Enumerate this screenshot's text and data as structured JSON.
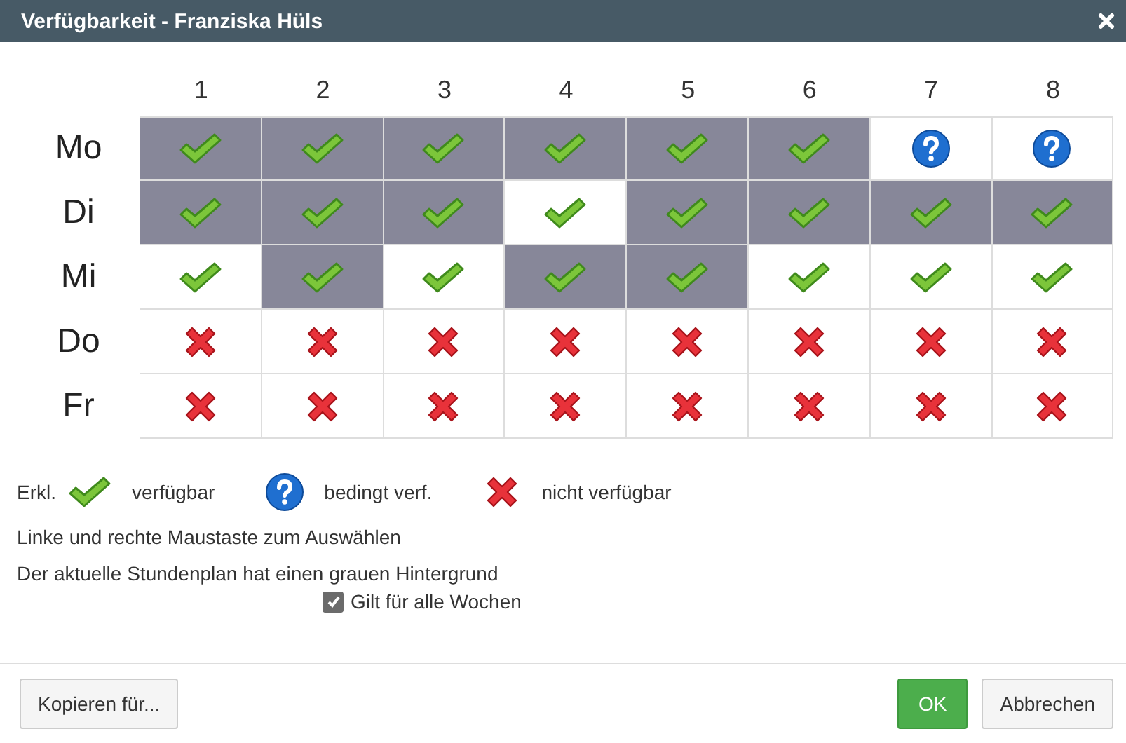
{
  "window": {
    "title": "Verfügbarkeit - Franziska Hüls"
  },
  "columns": [
    "1",
    "2",
    "3",
    "4",
    "5",
    "6",
    "7",
    "8"
  ],
  "rows": [
    {
      "day": "Mo",
      "cells": [
        {
          "kind": "yes",
          "current": true
        },
        {
          "kind": "yes",
          "current": true
        },
        {
          "kind": "yes",
          "current": true
        },
        {
          "kind": "yes",
          "current": true
        },
        {
          "kind": "yes",
          "current": true
        },
        {
          "kind": "yes",
          "current": true
        },
        {
          "kind": "maybe",
          "current": false
        },
        {
          "kind": "maybe",
          "current": false
        }
      ]
    },
    {
      "day": "Di",
      "cells": [
        {
          "kind": "yes",
          "current": true
        },
        {
          "kind": "yes",
          "current": true
        },
        {
          "kind": "yes",
          "current": true
        },
        {
          "kind": "yes",
          "current": false
        },
        {
          "kind": "yes",
          "current": true
        },
        {
          "kind": "yes",
          "current": true
        },
        {
          "kind": "yes",
          "current": true
        },
        {
          "kind": "yes",
          "current": true
        }
      ]
    },
    {
      "day": "Mi",
      "cells": [
        {
          "kind": "yes",
          "current": false
        },
        {
          "kind": "yes",
          "current": true
        },
        {
          "kind": "yes",
          "current": false
        },
        {
          "kind": "yes",
          "current": true
        },
        {
          "kind": "yes",
          "current": true
        },
        {
          "kind": "yes",
          "current": false
        },
        {
          "kind": "yes",
          "current": false
        },
        {
          "kind": "yes",
          "current": false
        }
      ]
    },
    {
      "day": "Do",
      "cells": [
        {
          "kind": "no",
          "current": false
        },
        {
          "kind": "no",
          "current": false
        },
        {
          "kind": "no",
          "current": false
        },
        {
          "kind": "no",
          "current": false
        },
        {
          "kind": "no",
          "current": false
        },
        {
          "kind": "no",
          "current": false
        },
        {
          "kind": "no",
          "current": false
        },
        {
          "kind": "no",
          "current": false
        }
      ]
    },
    {
      "day": "Fr",
      "cells": [
        {
          "kind": "no",
          "current": false
        },
        {
          "kind": "no",
          "current": false
        },
        {
          "kind": "no",
          "current": false
        },
        {
          "kind": "no",
          "current": false
        },
        {
          "kind": "no",
          "current": false
        },
        {
          "kind": "no",
          "current": false
        },
        {
          "kind": "no",
          "current": false
        },
        {
          "kind": "no",
          "current": false
        }
      ]
    }
  ],
  "legend": {
    "label": "Erkl.",
    "items": [
      {
        "kind": "yes",
        "text": "verfügbar"
      },
      {
        "kind": "maybe",
        "text": "bedingt verf."
      },
      {
        "kind": "no",
        "text": "nicht verfügbar"
      }
    ]
  },
  "notes": [
    "Linke und rechte Maustaste zum Auswählen",
    "Der aktuelle Stundenplan hat einen grauen Hintergrund"
  ],
  "all_weeks": {
    "label": "Gilt für alle Wochen",
    "checked": true
  },
  "buttons": {
    "copy": "Kopieren für...",
    "ok": "OK",
    "cancel": "Abbrechen"
  }
}
